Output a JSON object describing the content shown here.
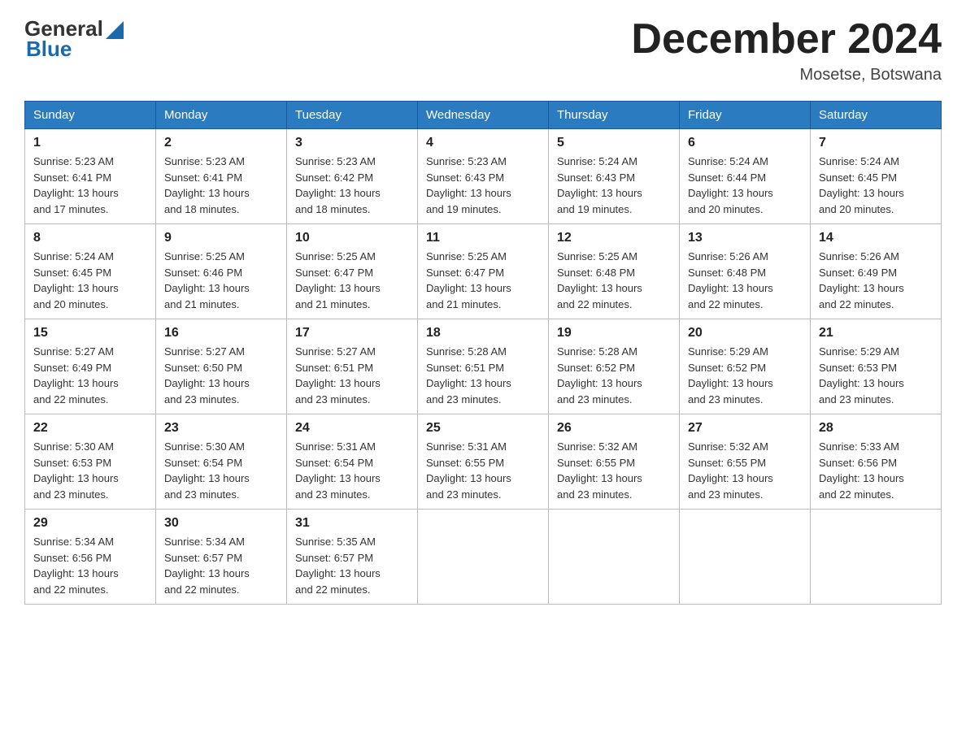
{
  "logo": {
    "general": "General",
    "blue": "Blue"
  },
  "title": "December 2024",
  "location": "Mosetse, Botswana",
  "weekdays": [
    "Sunday",
    "Monday",
    "Tuesday",
    "Wednesday",
    "Thursday",
    "Friday",
    "Saturday"
  ],
  "weeks": [
    [
      {
        "day": "1",
        "sunrise": "5:23 AM",
        "sunset": "6:41 PM",
        "daylight": "13 hours and 17 minutes."
      },
      {
        "day": "2",
        "sunrise": "5:23 AM",
        "sunset": "6:41 PM",
        "daylight": "13 hours and 18 minutes."
      },
      {
        "day": "3",
        "sunrise": "5:23 AM",
        "sunset": "6:42 PM",
        "daylight": "13 hours and 18 minutes."
      },
      {
        "day": "4",
        "sunrise": "5:23 AM",
        "sunset": "6:43 PM",
        "daylight": "13 hours and 19 minutes."
      },
      {
        "day": "5",
        "sunrise": "5:24 AM",
        "sunset": "6:43 PM",
        "daylight": "13 hours and 19 minutes."
      },
      {
        "day": "6",
        "sunrise": "5:24 AM",
        "sunset": "6:44 PM",
        "daylight": "13 hours and 20 minutes."
      },
      {
        "day": "7",
        "sunrise": "5:24 AM",
        "sunset": "6:45 PM",
        "daylight": "13 hours and 20 minutes."
      }
    ],
    [
      {
        "day": "8",
        "sunrise": "5:24 AM",
        "sunset": "6:45 PM",
        "daylight": "13 hours and 20 minutes."
      },
      {
        "day": "9",
        "sunrise": "5:25 AM",
        "sunset": "6:46 PM",
        "daylight": "13 hours and 21 minutes."
      },
      {
        "day": "10",
        "sunrise": "5:25 AM",
        "sunset": "6:47 PM",
        "daylight": "13 hours and 21 minutes."
      },
      {
        "day": "11",
        "sunrise": "5:25 AM",
        "sunset": "6:47 PM",
        "daylight": "13 hours and 21 minutes."
      },
      {
        "day": "12",
        "sunrise": "5:25 AM",
        "sunset": "6:48 PM",
        "daylight": "13 hours and 22 minutes."
      },
      {
        "day": "13",
        "sunrise": "5:26 AM",
        "sunset": "6:48 PM",
        "daylight": "13 hours and 22 minutes."
      },
      {
        "day": "14",
        "sunrise": "5:26 AM",
        "sunset": "6:49 PM",
        "daylight": "13 hours and 22 minutes."
      }
    ],
    [
      {
        "day": "15",
        "sunrise": "5:27 AM",
        "sunset": "6:49 PM",
        "daylight": "13 hours and 22 minutes."
      },
      {
        "day": "16",
        "sunrise": "5:27 AM",
        "sunset": "6:50 PM",
        "daylight": "13 hours and 23 minutes."
      },
      {
        "day": "17",
        "sunrise": "5:27 AM",
        "sunset": "6:51 PM",
        "daylight": "13 hours and 23 minutes."
      },
      {
        "day": "18",
        "sunrise": "5:28 AM",
        "sunset": "6:51 PM",
        "daylight": "13 hours and 23 minutes."
      },
      {
        "day": "19",
        "sunrise": "5:28 AM",
        "sunset": "6:52 PM",
        "daylight": "13 hours and 23 minutes."
      },
      {
        "day": "20",
        "sunrise": "5:29 AM",
        "sunset": "6:52 PM",
        "daylight": "13 hours and 23 minutes."
      },
      {
        "day": "21",
        "sunrise": "5:29 AM",
        "sunset": "6:53 PM",
        "daylight": "13 hours and 23 minutes."
      }
    ],
    [
      {
        "day": "22",
        "sunrise": "5:30 AM",
        "sunset": "6:53 PM",
        "daylight": "13 hours and 23 minutes."
      },
      {
        "day": "23",
        "sunrise": "5:30 AM",
        "sunset": "6:54 PM",
        "daylight": "13 hours and 23 minutes."
      },
      {
        "day": "24",
        "sunrise": "5:31 AM",
        "sunset": "6:54 PM",
        "daylight": "13 hours and 23 minutes."
      },
      {
        "day": "25",
        "sunrise": "5:31 AM",
        "sunset": "6:55 PM",
        "daylight": "13 hours and 23 minutes."
      },
      {
        "day": "26",
        "sunrise": "5:32 AM",
        "sunset": "6:55 PM",
        "daylight": "13 hours and 23 minutes."
      },
      {
        "day": "27",
        "sunrise": "5:32 AM",
        "sunset": "6:55 PM",
        "daylight": "13 hours and 23 minutes."
      },
      {
        "day": "28",
        "sunrise": "5:33 AM",
        "sunset": "6:56 PM",
        "daylight": "13 hours and 22 minutes."
      }
    ],
    [
      {
        "day": "29",
        "sunrise": "5:34 AM",
        "sunset": "6:56 PM",
        "daylight": "13 hours and 22 minutes."
      },
      {
        "day": "30",
        "sunrise": "5:34 AM",
        "sunset": "6:57 PM",
        "daylight": "13 hours and 22 minutes."
      },
      {
        "day": "31",
        "sunrise": "5:35 AM",
        "sunset": "6:57 PM",
        "daylight": "13 hours and 22 minutes."
      },
      null,
      null,
      null,
      null
    ]
  ]
}
